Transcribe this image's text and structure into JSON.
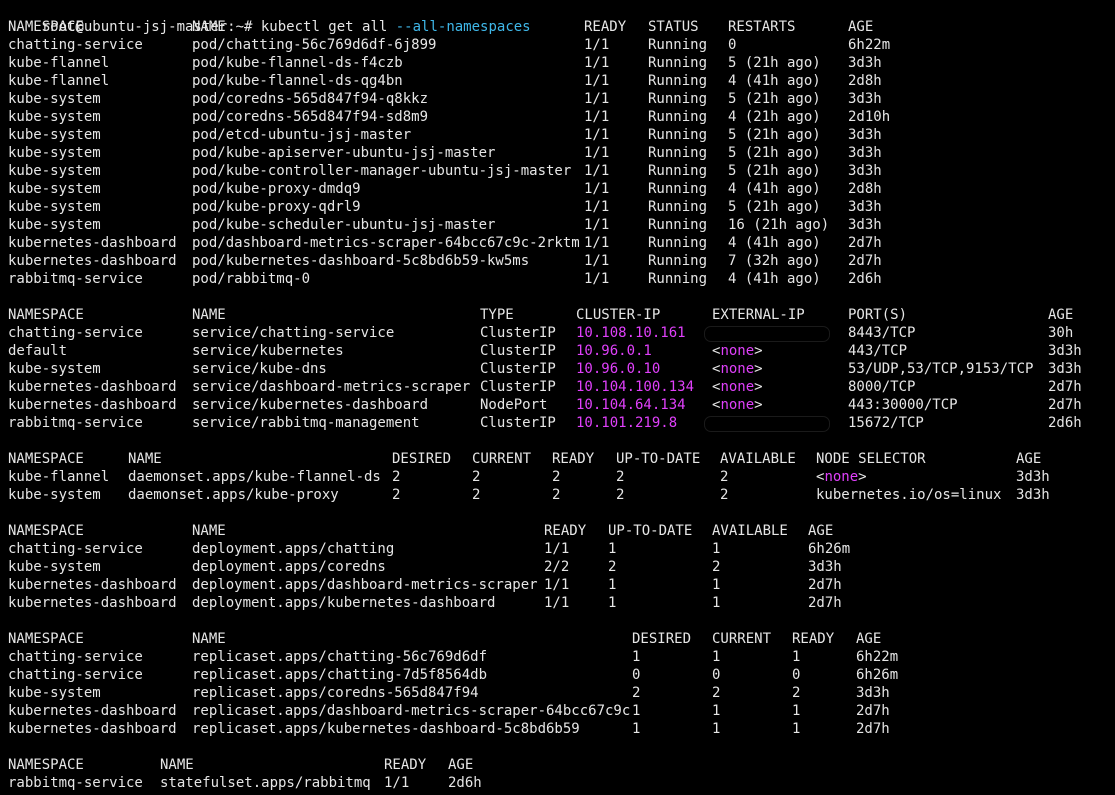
{
  "prompt": {
    "user_host": "root@ubuntu-jsj-master:~#",
    "command": "kubectl get all",
    "flag": "--all-namespaces"
  },
  "colors": {
    "background": "#000000",
    "foreground": "#e6e6e6",
    "ip_highlight": "#e040fb",
    "flag_highlight": "#3fb7e8"
  },
  "sections": [
    {
      "name": "pods",
      "headers": [
        "NAMESPACE",
        "NAME",
        "READY",
        "STATUS",
        "RESTARTS",
        "AGE"
      ],
      "rows": [
        [
          "chatting-service",
          "pod/chatting-56c769d6df-6j899",
          "1/1",
          "Running",
          "0",
          "6h22m"
        ],
        [
          "kube-flannel",
          "pod/kube-flannel-ds-f4czb",
          "1/1",
          "Running",
          "5 (21h ago)",
          "3d3h"
        ],
        [
          "kube-flannel",
          "pod/kube-flannel-ds-qg4bn",
          "1/1",
          "Running",
          "4 (41h ago)",
          "2d8h"
        ],
        [
          "kube-system",
          "pod/coredns-565d847f94-q8kkz",
          "1/1",
          "Running",
          "5 (21h ago)",
          "3d3h"
        ],
        [
          "kube-system",
          "pod/coredns-565d847f94-sd8m9",
          "1/1",
          "Running",
          "4 (21h ago)",
          "2d10h"
        ],
        [
          "kube-system",
          "pod/etcd-ubuntu-jsj-master",
          "1/1",
          "Running",
          "5 (21h ago)",
          "3d3h"
        ],
        [
          "kube-system",
          "pod/kube-apiserver-ubuntu-jsj-master",
          "1/1",
          "Running",
          "5 (21h ago)",
          "3d3h"
        ],
        [
          "kube-system",
          "pod/kube-controller-manager-ubuntu-jsj-master",
          "1/1",
          "Running",
          "5 (21h ago)",
          "3d3h"
        ],
        [
          "kube-system",
          "pod/kube-proxy-dmdq9",
          "1/1",
          "Running",
          "4 (41h ago)",
          "2d8h"
        ],
        [
          "kube-system",
          "pod/kube-proxy-qdrl9",
          "1/1",
          "Running",
          "5 (21h ago)",
          "3d3h"
        ],
        [
          "kube-system",
          "pod/kube-scheduler-ubuntu-jsj-master",
          "1/1",
          "Running",
          "16 (21h ago)",
          "3d3h"
        ],
        [
          "kubernetes-dashboard",
          "pod/dashboard-metrics-scraper-64bcc67c9c-2rktm",
          "1/1",
          "Running",
          "4 (41h ago)",
          "2d7h"
        ],
        [
          "kubernetes-dashboard",
          "pod/kubernetes-dashboard-5c8bd6b59-kw5ms",
          "1/1",
          "Running",
          "7 (32h ago)",
          "2d7h"
        ],
        [
          "rabbitmq-service",
          "pod/rabbitmq-0",
          "1/1",
          "Running",
          "4 (41h ago)",
          "2d6h"
        ]
      ]
    },
    {
      "name": "services",
      "headers": [
        "NAMESPACE",
        "NAME",
        "TYPE",
        "CLUSTER-IP",
        "EXTERNAL-IP",
        "PORT(S)",
        "AGE"
      ],
      "rows": [
        [
          "chatting-service",
          "service/chatting-service",
          "ClusterIP",
          "10.108.10.161",
          "",
          "8443/TCP",
          "30h"
        ],
        [
          "default",
          "service/kubernetes",
          "ClusterIP",
          "10.96.0.1",
          "<none>",
          "443/TCP",
          "3d3h"
        ],
        [
          "kube-system",
          "service/kube-dns",
          "ClusterIP",
          "10.96.0.10",
          "<none>",
          "53/UDP,53/TCP,9153/TCP",
          "3d3h"
        ],
        [
          "kubernetes-dashboard",
          "service/dashboard-metrics-scraper",
          "ClusterIP",
          "10.104.100.134",
          "<none>",
          "8000/TCP",
          "2d7h"
        ],
        [
          "kubernetes-dashboard",
          "service/kubernetes-dashboard",
          "NodePort",
          "10.104.64.134",
          "<none>",
          "443:30000/TCP",
          "2d7h"
        ],
        [
          "rabbitmq-service",
          "service/rabbitmq-management",
          "ClusterIP",
          "10.101.219.8",
          "",
          "15672/TCP",
          "2d6h"
        ]
      ]
    },
    {
      "name": "daemonsets",
      "headers": [
        "NAMESPACE",
        "NAME",
        "DESIRED",
        "CURRENT",
        "READY",
        "UP-TO-DATE",
        "AVAILABLE",
        "NODE SELECTOR",
        "AGE"
      ],
      "rows": [
        [
          "kube-flannel",
          "daemonset.apps/kube-flannel-ds",
          "2",
          "2",
          "2",
          "2",
          "2",
          "<none>",
          "3d3h"
        ],
        [
          "kube-system",
          "daemonset.apps/kube-proxy",
          "2",
          "2",
          "2",
          "2",
          "2",
          "kubernetes.io/os=linux",
          "3d3h"
        ]
      ]
    },
    {
      "name": "deployments",
      "headers": [
        "NAMESPACE",
        "NAME",
        "READY",
        "UP-TO-DATE",
        "AVAILABLE",
        "AGE"
      ],
      "rows": [
        [
          "chatting-service",
          "deployment.apps/chatting",
          "1/1",
          "1",
          "1",
          "6h26m"
        ],
        [
          "kube-system",
          "deployment.apps/coredns",
          "2/2",
          "2",
          "2",
          "3d3h"
        ],
        [
          "kubernetes-dashboard",
          "deployment.apps/dashboard-metrics-scraper",
          "1/1",
          "1",
          "1",
          "2d7h"
        ],
        [
          "kubernetes-dashboard",
          "deployment.apps/kubernetes-dashboard",
          "1/1",
          "1",
          "1",
          "2d7h"
        ]
      ]
    },
    {
      "name": "replicasets",
      "headers": [
        "NAMESPACE",
        "NAME",
        "DESIRED",
        "CURRENT",
        "READY",
        "AGE"
      ],
      "rows": [
        [
          "chatting-service",
          "replicaset.apps/chatting-56c769d6df",
          "1",
          "1",
          "1",
          "6h22m"
        ],
        [
          "chatting-service",
          "replicaset.apps/chatting-7d5f8564db",
          "0",
          "0",
          "0",
          "6h26m"
        ],
        [
          "kube-system",
          "replicaset.apps/coredns-565d847f94",
          "2",
          "2",
          "2",
          "3d3h"
        ],
        [
          "kubernetes-dashboard",
          "replicaset.apps/dashboard-metrics-scraper-64bcc67c9c",
          "1",
          "1",
          "1",
          "2d7h"
        ],
        [
          "kubernetes-dashboard",
          "replicaset.apps/kubernetes-dashboard-5c8bd6b59",
          "1",
          "1",
          "1",
          "2d7h"
        ]
      ]
    },
    {
      "name": "statefulsets",
      "headers": [
        "NAMESPACE",
        "NAME",
        "READY",
        "AGE"
      ],
      "rows": [
        [
          "rabbitmq-service",
          "statefulset.apps/rabbitmq",
          "1/1",
          "2d6h"
        ]
      ]
    }
  ]
}
